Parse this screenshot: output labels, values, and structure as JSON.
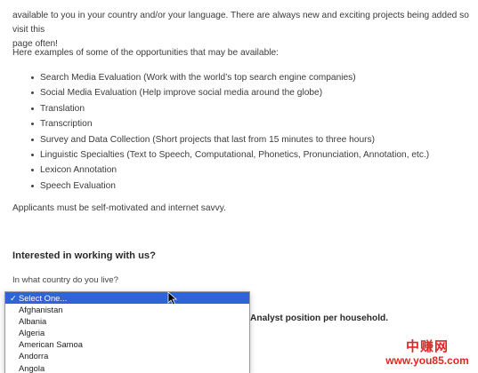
{
  "intro": {
    "line1": "available to you in your country and/or your language. There are always new and exciting projects being added so visit this",
    "line2": "page often!"
  },
  "examples_intro": "Here examples of some of the opportunities that may be available:",
  "opportunities": [
    "Search Media Evaluation (Work with the world’s top search engine companies)",
    "Social Media Evaluation (Help improve social media around the globe)",
    "Translation",
    "Transcription",
    "Survey and Data Collection (Short projects that last from 15 minutes to three hours)",
    "Linguistic Specialties (Text to Speech, Computational, Phonetics, Pronunciation, Annotation, etc.)",
    "Lexicon Annotation",
    "Speech Evaluation"
  ],
  "applicants_note": "Applicants must be self-motivated and internet savvy.",
  "section_heading": "Interested in working with us?",
  "country_question": "In what country do you live?",
  "country_dropdown": {
    "selected": "Select One...",
    "options": [
      "Afghanistan",
      "Albania",
      "Algeria",
      "American Samoa",
      "Andorra",
      "Angola"
    ]
  },
  "partial_text": "Analyst position per household.",
  "watermark": {
    "chinese": "中赚网",
    "url": "www.you85.com"
  },
  "colors": {
    "selection": "#2f63d6",
    "watermark": "#e02626"
  }
}
